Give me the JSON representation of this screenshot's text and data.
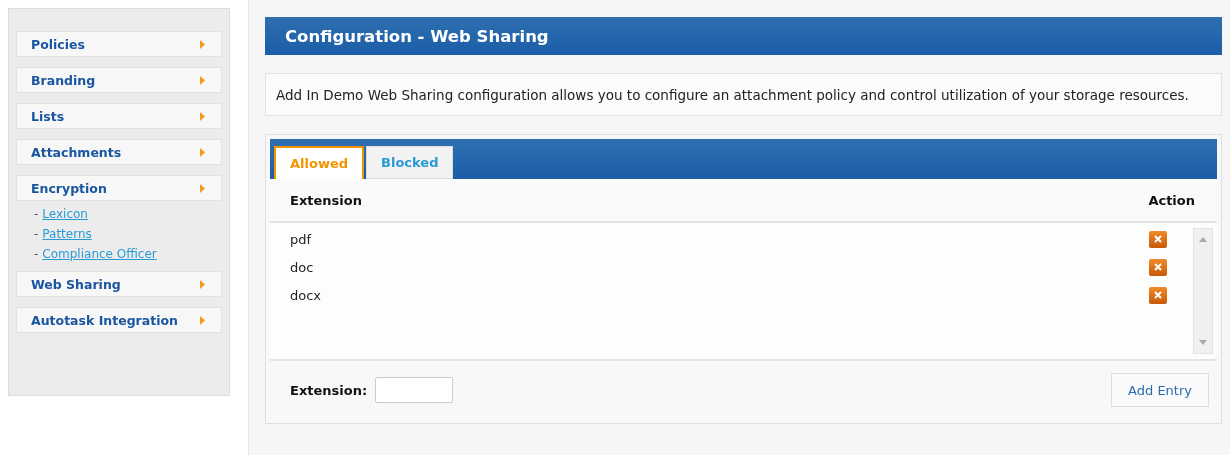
{
  "sidebar": {
    "items": [
      {
        "label": "Policies"
      },
      {
        "label": "Branding"
      },
      {
        "label": "Lists"
      },
      {
        "label": "Attachments"
      },
      {
        "label": "Encryption",
        "children": [
          {
            "bullet": "-",
            "label": "Lexicon"
          },
          {
            "bullet": "-",
            "label": "Patterns"
          },
          {
            "bullet": "-",
            "label": "Compliance Officer"
          }
        ]
      },
      {
        "label": "Web Sharing"
      },
      {
        "label": "Autotask Integration"
      }
    ]
  },
  "header": {
    "title": "Configuration - Web Sharing"
  },
  "description": "Add In Demo Web Sharing configuration allows you to configure an attachment policy and control utilization of your storage resources.",
  "tabs": [
    {
      "label": "Allowed",
      "selected": true
    },
    {
      "label": "Blocked",
      "selected": false
    }
  ],
  "table": {
    "columns": [
      "Extension",
      "Action"
    ],
    "rows": [
      {
        "extension": "pdf"
      },
      {
        "extension": "doc"
      },
      {
        "extension": "docx"
      }
    ]
  },
  "form": {
    "label": "Extension:",
    "button": "Add Entry"
  }
}
